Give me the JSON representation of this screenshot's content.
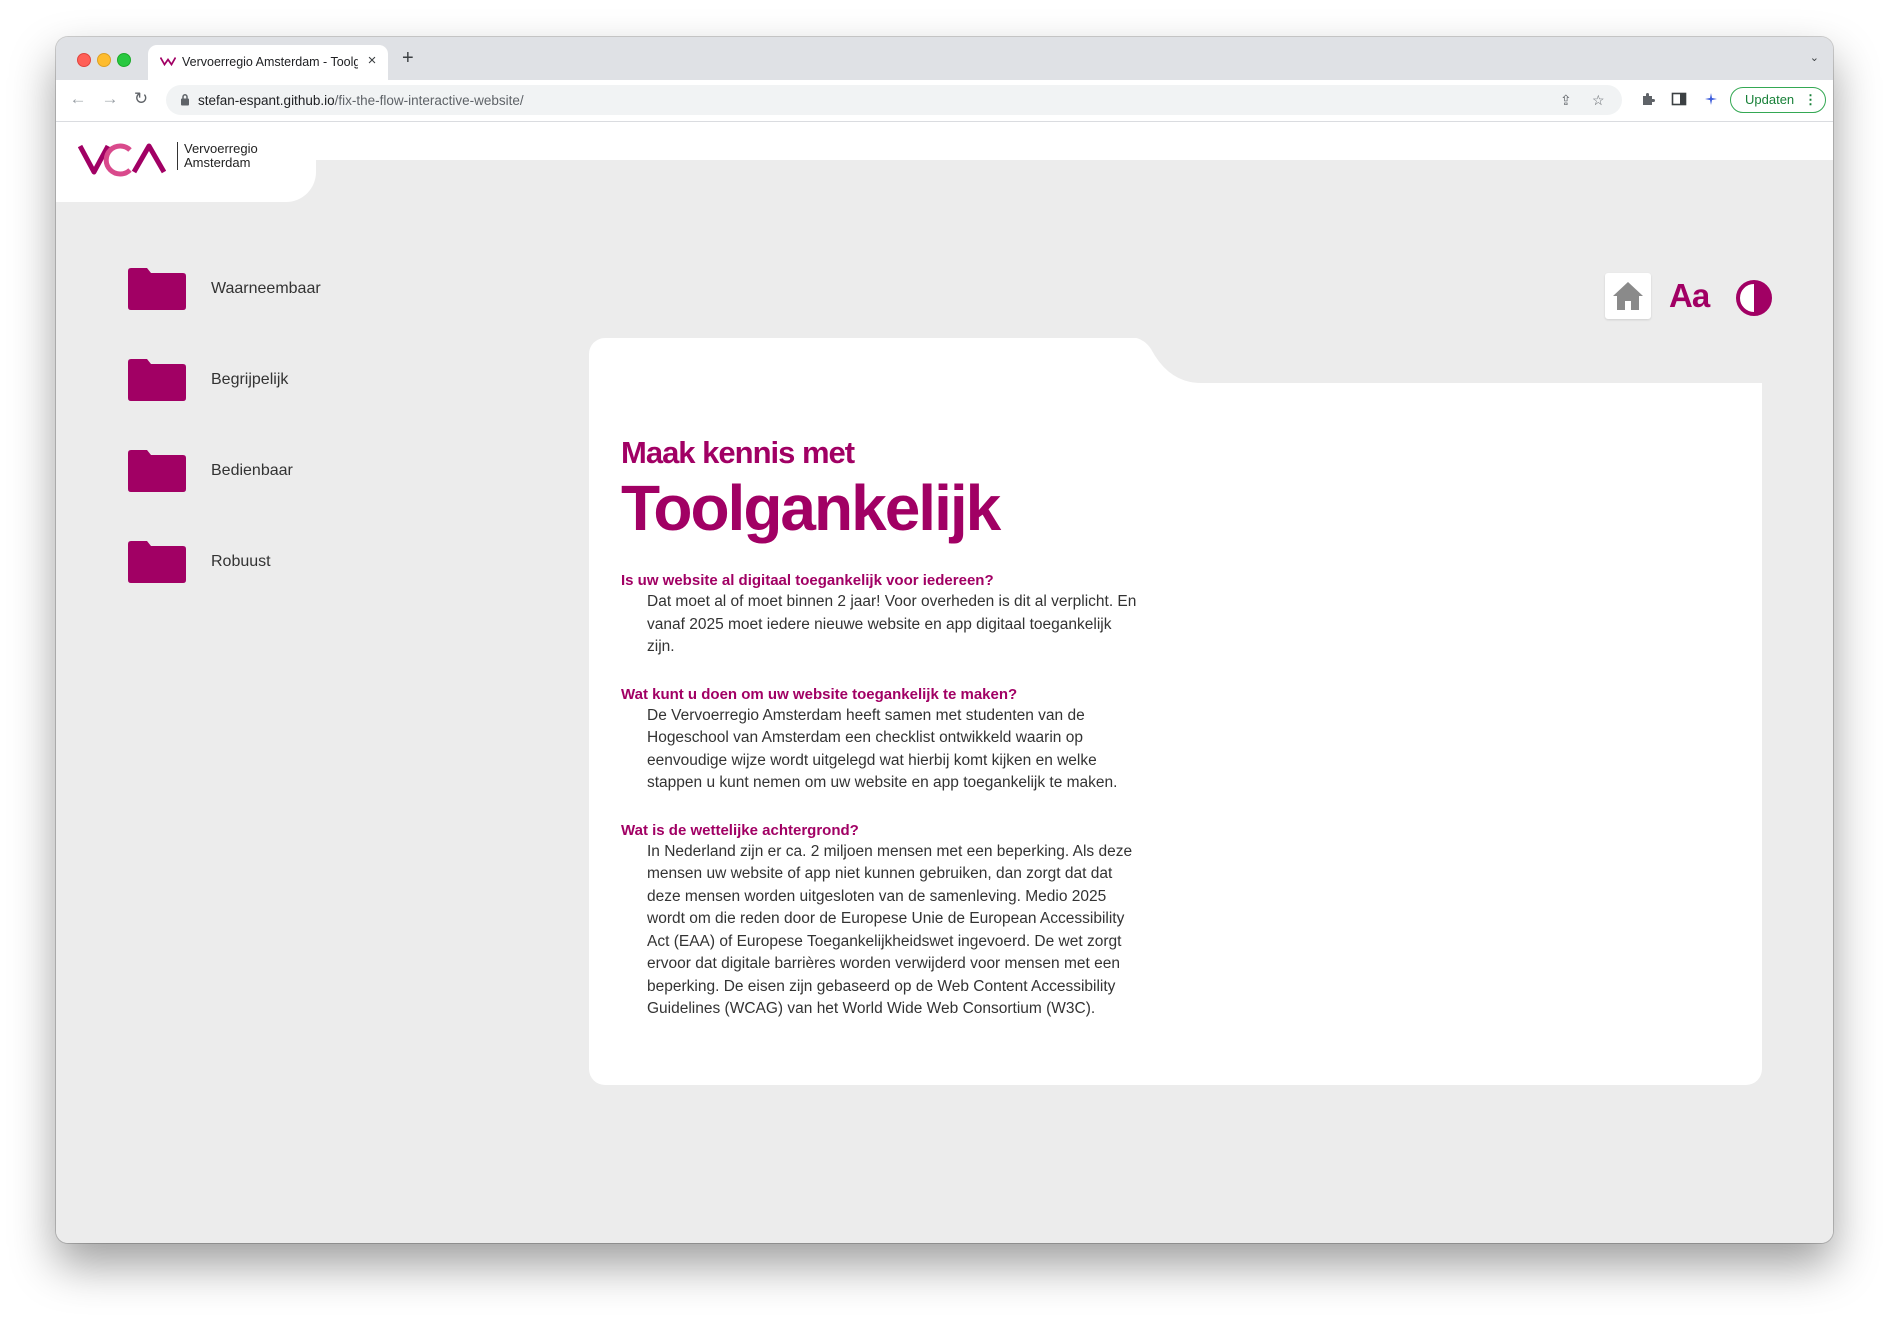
{
  "browser": {
    "tab_title": "Vervoerregio Amsterdam - Toolgankelijk",
    "url_host": "stefan-espant.github.io",
    "url_path": "/fix-the-flow-interactive-website/",
    "update_label": "Updaten"
  },
  "logo": {
    "line1": "Vervoerregio",
    "line2": "Amsterdam"
  },
  "nav": {
    "items": [
      {
        "label": "Waarneembaar"
      },
      {
        "label": "Begrijpelijk"
      },
      {
        "label": "Bedienbaar"
      },
      {
        "label": "Robuust"
      }
    ]
  },
  "tools": {
    "font_label": "Aa",
    "home_icon": "home-icon",
    "contrast_icon": "contrast-icon"
  },
  "main": {
    "subtitle": "Maak kennis met",
    "title": "Toolgankelijk",
    "sections": [
      {
        "question": "Is uw website al digitaal toegankelijk voor iedereen?",
        "answer": "Dat moet al of moet binnen 2 jaar! Voor overheden is dit al verplicht. En vanaf 2025 moet iedere nieuwe website en app digitaal toegankelijk zijn."
      },
      {
        "question": "Wat kunt u doen om uw website toegankelijk te maken?",
        "answer": "De Vervoerregio Amsterdam heeft samen met studenten van de Hogeschool van Amsterdam een checklist ontwikkeld waarin op eenvoudige wijze wordt uitgelegd wat hierbij komt kijken en welke stappen u kunt nemen om uw website en app toegankelijk te maken."
      },
      {
        "question": "Wat is de wettelijke achtergrond?",
        "answer": "In Nederland zijn er ca. 2 miljoen mensen met een beperking. Als deze mensen uw website of app niet kunnen gebruiken, dan zorgt dat dat deze mensen worden uitgesloten van de samenleving. Medio 2025 wordt om die reden door de Europese Unie de European Accessibility Act (EAA) of Europese Toegankelijkheidswet ingevoerd. De wet zorgt ervoor dat digitale barrières worden verwijderd voor mensen met een beperking. De eisen zijn gebaseerd op de Web Content Accessibility Guidelines (WCAG) van het World Wide Web Consortium (W3C)."
      }
    ]
  },
  "colors": {
    "brand": "#a10064",
    "page_bg": "#ececec"
  }
}
